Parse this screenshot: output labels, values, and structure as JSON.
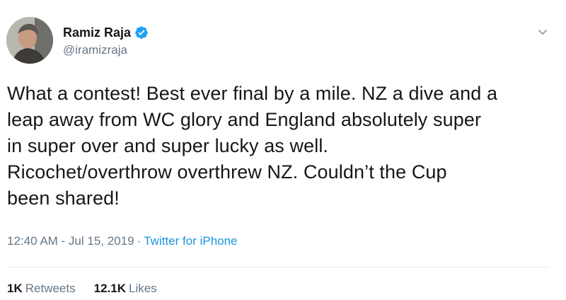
{
  "user": {
    "display_name": "Ramiz Raja",
    "handle": "@iramizraja",
    "verified": true,
    "avatar_icon": "profile-photo"
  },
  "tweet": {
    "lines": [
      "What a contest! Best ever final by a mile. NZ a dive and a",
      "leap away from WC glory and England absolutely super",
      "in super over and super lucky as well.",
      "Ricochet/overthrow overthrew NZ. Couldn’t the Cup",
      "been shared!"
    ],
    "timestamp": "12:40 AM - Jul 15, 2019",
    "separator": "·",
    "source": "Twitter for iPhone"
  },
  "stats": {
    "retweets_count": "1K",
    "retweets_label": "Retweets",
    "likes_count": "12.1K",
    "likes_label": "Likes"
  },
  "colors": {
    "text": "#14171a",
    "secondary": "#657786",
    "link": "#1b95e0",
    "verified": "#1da1f2",
    "divider": "#e6ecf0"
  },
  "icons": {
    "verified": "verified-badge-icon",
    "menu": "chevron-down-icon"
  }
}
